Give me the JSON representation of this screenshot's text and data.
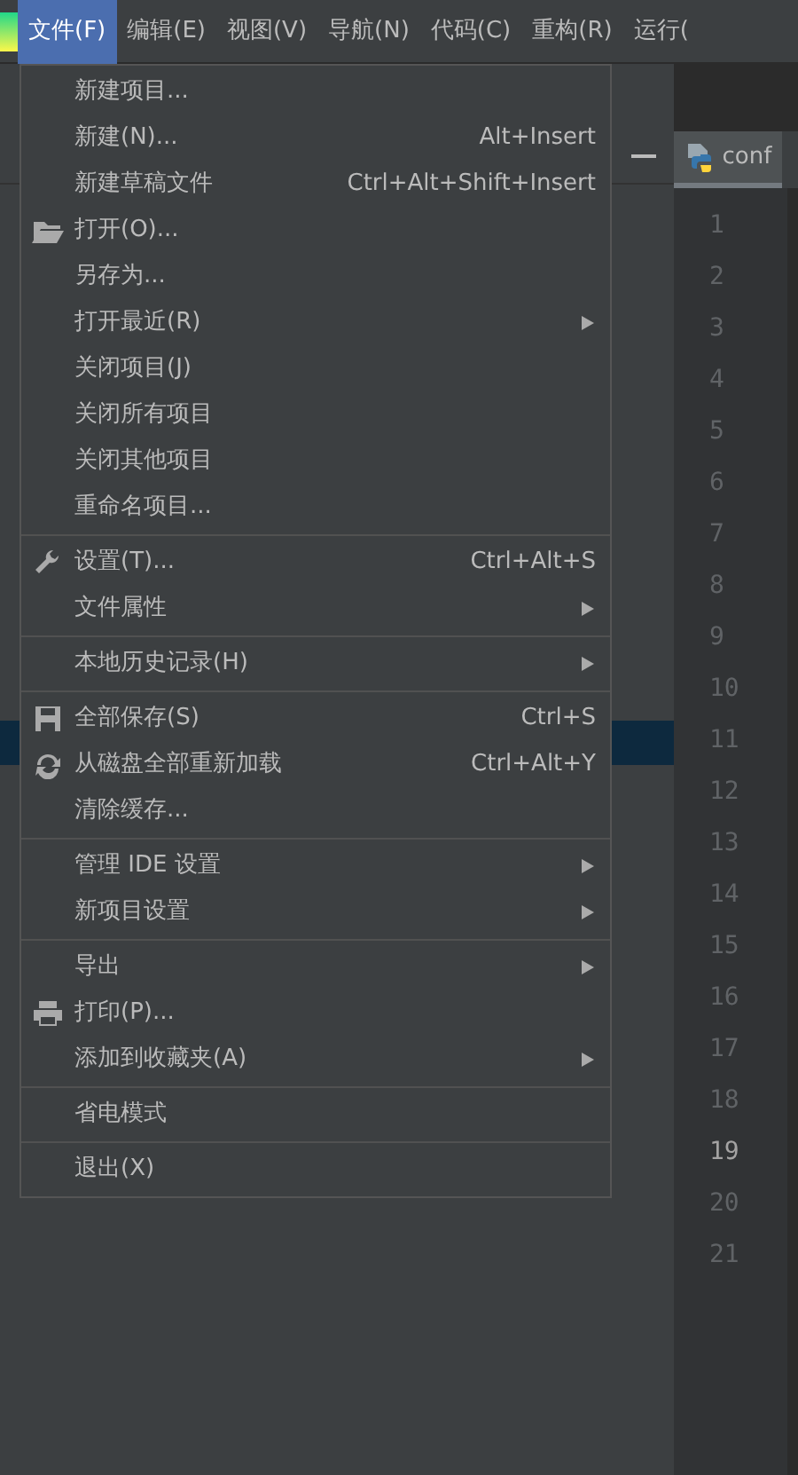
{
  "menubar": [
    {
      "label": "文件(F)",
      "selected": true
    },
    {
      "label": "编辑(E)",
      "selected": false
    },
    {
      "label": "视图(V)",
      "selected": false
    },
    {
      "label": "导航(N)",
      "selected": false
    },
    {
      "label": "代码(C)",
      "selected": false
    },
    {
      "label": "重构(R)",
      "selected": false
    },
    {
      "label": "运行(",
      "selected": false
    }
  ],
  "editor_tab": {
    "label": "conf"
  },
  "line_numbers": [
    {
      "label": "1",
      "current": false
    },
    {
      "label": "2",
      "current": false
    },
    {
      "label": "3",
      "current": false
    },
    {
      "label": "4",
      "current": false
    },
    {
      "label": "5",
      "current": false
    },
    {
      "label": "6",
      "current": false
    },
    {
      "label": "7",
      "current": false
    },
    {
      "label": "8",
      "current": false
    },
    {
      "label": "9",
      "current": false
    },
    {
      "label": "10",
      "current": false
    },
    {
      "label": "11",
      "current": false
    },
    {
      "label": "12",
      "current": false
    },
    {
      "label": "13",
      "current": false
    },
    {
      "label": "14",
      "current": false
    },
    {
      "label": "15",
      "current": false
    },
    {
      "label": "16",
      "current": false
    },
    {
      "label": "17",
      "current": false
    },
    {
      "label": "18",
      "current": false
    },
    {
      "label": "19",
      "current": true
    },
    {
      "label": "20",
      "current": false
    },
    {
      "label": "21",
      "current": false
    }
  ],
  "file_menu": [
    {
      "kind": "item",
      "label": "新建项目..."
    },
    {
      "kind": "item",
      "label": "新建(N)...",
      "shortcut": "Alt+Insert"
    },
    {
      "kind": "item",
      "label": "新建草稿文件",
      "shortcut": "Ctrl+Alt+Shift+Insert"
    },
    {
      "kind": "item",
      "label": "打开(O)..."
    },
    {
      "kind": "item",
      "label": "另存为..."
    },
    {
      "kind": "item",
      "label": "打开最近(R)",
      "submenu": true
    },
    {
      "kind": "item",
      "label": "关闭项目(J)"
    },
    {
      "kind": "item",
      "label": "关闭所有项目"
    },
    {
      "kind": "item",
      "label": "关闭其他项目"
    },
    {
      "kind": "item",
      "label": "重命名项目..."
    },
    {
      "kind": "separator"
    },
    {
      "kind": "item",
      "label": "设置(T)...",
      "shortcut": "Ctrl+Alt+S"
    },
    {
      "kind": "item",
      "label": "文件属性",
      "submenu": true
    },
    {
      "kind": "separator"
    },
    {
      "kind": "item",
      "label": "本地历史记录(H)",
      "submenu": true
    },
    {
      "kind": "separator"
    },
    {
      "kind": "item",
      "label": "全部保存(S)",
      "shortcut": "Ctrl+S"
    },
    {
      "kind": "item",
      "label": "从磁盘全部重新加载",
      "shortcut": "Ctrl+Alt+Y"
    },
    {
      "kind": "item",
      "label": "清除缓存..."
    },
    {
      "kind": "separator"
    },
    {
      "kind": "item",
      "label": "管理 IDE 设置",
      "submenu": true
    },
    {
      "kind": "item",
      "label": "新项目设置",
      "submenu": true
    },
    {
      "kind": "separator"
    },
    {
      "kind": "item",
      "label": "导出",
      "submenu": true
    },
    {
      "kind": "item",
      "label": "打印(P)..."
    },
    {
      "kind": "item",
      "label": "添加到收藏夹(A)",
      "submenu": true
    },
    {
      "kind": "separator"
    },
    {
      "kind": "item",
      "label": "省电模式"
    },
    {
      "kind": "separator"
    },
    {
      "kind": "item",
      "label": "退出(X)"
    }
  ]
}
